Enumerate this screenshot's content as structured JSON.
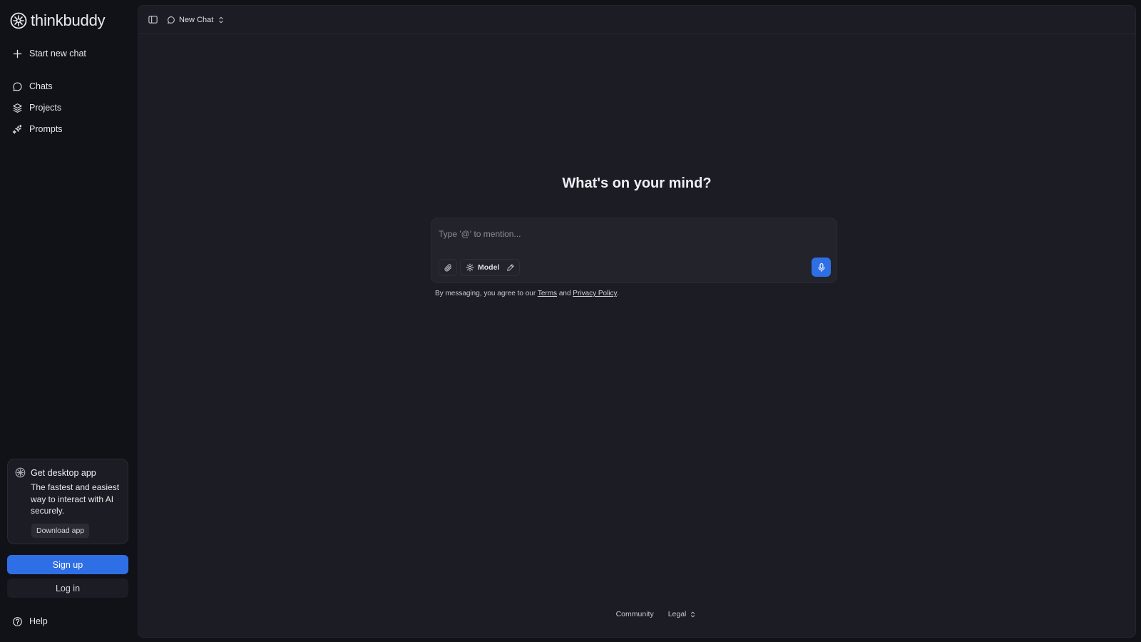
{
  "sidebar": {
    "brand": "thinkbuddy",
    "new_chat": "Start new chat",
    "nav": {
      "chats": "Chats",
      "projects": "Projects",
      "prompts": "Prompts"
    },
    "promo": {
      "title": "Get desktop app",
      "description": "The fastest and easiest way to interact with AI securely.",
      "button": "Download app"
    },
    "signup": "Sign up",
    "login": "Log in",
    "help": "Help"
  },
  "topbar": {
    "chat_title": "New Chat"
  },
  "main": {
    "headline": "What's on your mind?",
    "input_placeholder": "Type '@' to mention...",
    "model_label": "Model",
    "disclaimer": {
      "prefix": "By messaging, you agree to our",
      "terms": "Terms",
      "and": "and",
      "privacy": "Privacy Policy",
      "suffix": "."
    }
  },
  "footer": {
    "community": "Community",
    "legal": "Legal"
  },
  "colors": {
    "background": "#111217",
    "panel": "#1b1c24",
    "accent": "#2f6fe6"
  }
}
